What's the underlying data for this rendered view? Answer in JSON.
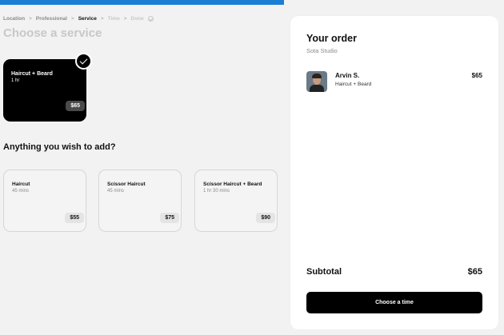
{
  "breadcrumb": {
    "items": [
      "Location",
      "Professional",
      "Service",
      "Time",
      "Done"
    ],
    "separator": ">"
  },
  "page_title": "Choose a service",
  "selected_service": {
    "name": "Haircut + Beard",
    "duration": "1 hr",
    "price": "$65"
  },
  "addons": {
    "heading": "Anything you wish to add?",
    "items": [
      {
        "name": "Haircut",
        "duration": "45 mins",
        "price": "$55"
      },
      {
        "name": "Scissor Haircut",
        "duration": "45 mins",
        "price": "$75"
      },
      {
        "name": "Scissor Haircut + Beard",
        "duration": "1 hr 30 mins",
        "price": "$90"
      }
    ]
  },
  "order": {
    "title": "Your order",
    "studio": "Sota Studio",
    "line": {
      "staff": "Arvin S.",
      "service": "Haircut + Beard",
      "price": "$65"
    },
    "subtotal_label": "Subtotal",
    "subtotal_value": "$65",
    "cta_label": "Choose a time"
  },
  "colors": {
    "accent_bar": "#1a7fd4",
    "primary": "#000000",
    "background": "#f2f2f2"
  }
}
